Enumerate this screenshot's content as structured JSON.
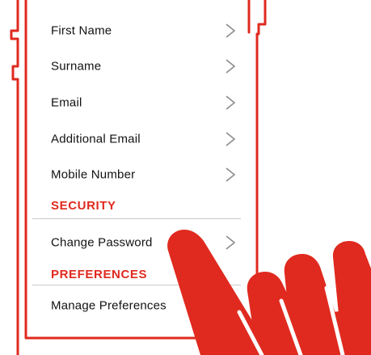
{
  "colors": {
    "accent": "#e02a1f",
    "text": "#111111",
    "divider": "#c9c9c9",
    "chevron": "#8c8c8c"
  },
  "profile_items": [
    {
      "label": "First Name",
      "icon": "chevron-right-icon"
    },
    {
      "label": "Surname",
      "icon": "chevron-right-icon"
    },
    {
      "label": "Email",
      "icon": "chevron-right-icon"
    },
    {
      "label": "Additional Email",
      "icon": "chevron-right-icon"
    },
    {
      "label": "Mobile Number",
      "icon": "chevron-right-icon"
    }
  ],
  "security": {
    "header": "SECURITY",
    "items": [
      {
        "label": "Change Password",
        "icon": "chevron-right-icon"
      }
    ]
  },
  "preferences": {
    "header": "PREFERENCES",
    "items": [
      {
        "label": "Manage Preferences"
      }
    ]
  },
  "overlay": {
    "icon": "pointing-hand-icon"
  }
}
